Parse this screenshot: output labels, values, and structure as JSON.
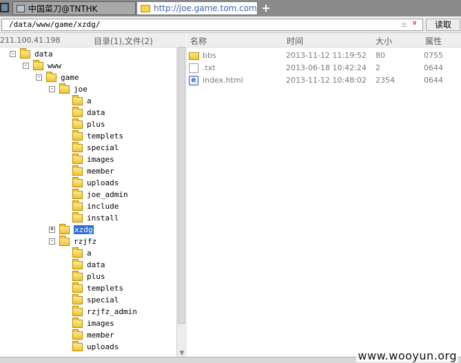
{
  "tabs": [
    {
      "label": "中国菜刀@TNTHK",
      "active": false
    },
    {
      "label": "http://joe.game.tom.com/logo...",
      "active": true
    }
  ],
  "new_tab_label": "+",
  "address": {
    "value": "/data/www/game/xzdg/",
    "extra": "±",
    "dropdown": "∨"
  },
  "go_button": "读取",
  "left_header": {
    "ip": "211.100.41.198",
    "counts": "目录(1),文件(2)"
  },
  "tree": [
    {
      "label": "data",
      "toggle": "-"
    },
    {
      "label": "www",
      "toggle": "-"
    },
    {
      "label": "game",
      "toggle": "-"
    },
    {
      "label": "joe",
      "toggle": "-"
    },
    {
      "label": "a"
    },
    {
      "label": "data"
    },
    {
      "label": "plus"
    },
    {
      "label": "templets"
    },
    {
      "label": "special"
    },
    {
      "label": "images"
    },
    {
      "label": "member"
    },
    {
      "label": "uploads"
    },
    {
      "label": "joe_admin"
    },
    {
      "label": "include"
    },
    {
      "label": "install"
    },
    {
      "label": "xzdg",
      "toggle": "+",
      "selected": true
    },
    {
      "label": "rzjfz",
      "toggle": "-"
    },
    {
      "label": "a"
    },
    {
      "label": "data"
    },
    {
      "label": "plus"
    },
    {
      "label": "templets"
    },
    {
      "label": "special"
    },
    {
      "label": "rzjfz_admin"
    },
    {
      "label": "images"
    },
    {
      "label": "member"
    },
    {
      "label": "uploads"
    }
  ],
  "file_columns": {
    "name": "名称",
    "time": "时间",
    "size": "大小",
    "attr": "属性"
  },
  "files": [
    {
      "name": "bbs",
      "type": "folder",
      "time": "2013-11-12 11:19:52",
      "size": "80",
      "attr": "0755"
    },
    {
      "name": ".txt",
      "type": "text",
      "time": "2013-06-18 10:42:24",
      "size": "2",
      "attr": "0644"
    },
    {
      "name": "index.html",
      "type": "html",
      "time": "2013-11-12 10:48:02",
      "size": "2354",
      "attr": "0644"
    }
  ],
  "watermark": "www.wooyun.org"
}
